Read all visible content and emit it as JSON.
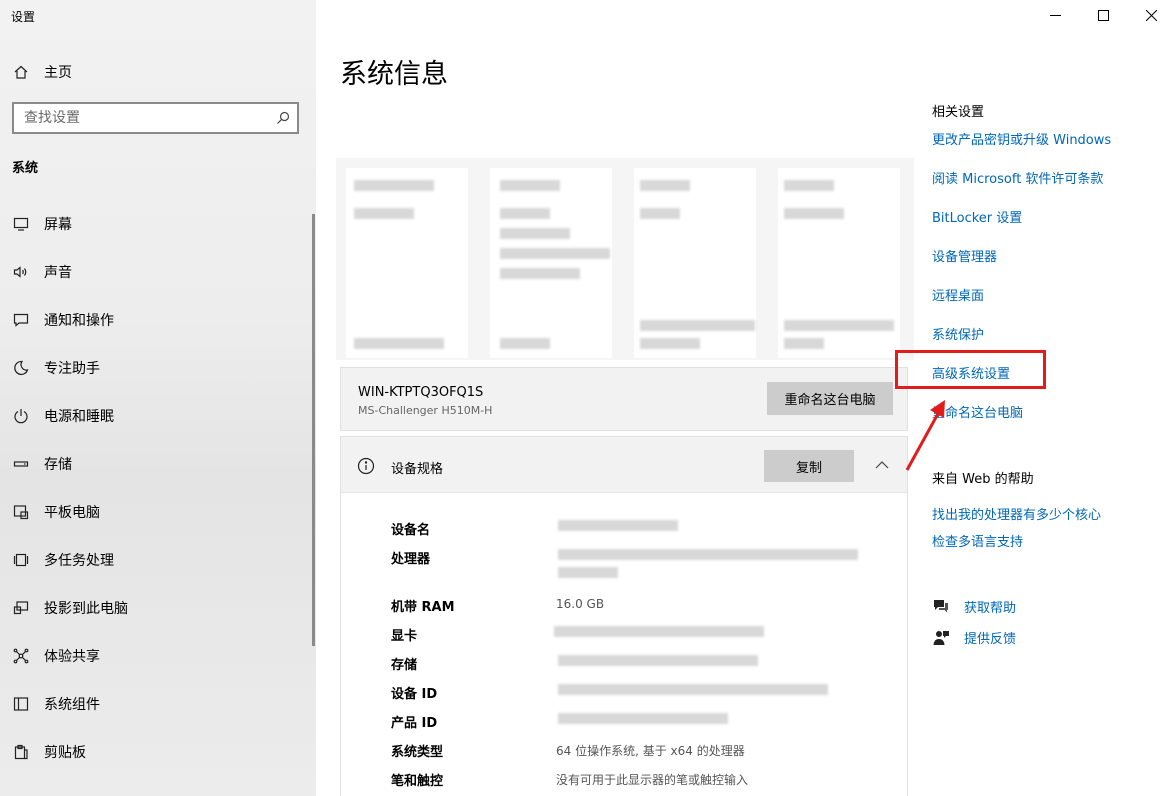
{
  "window": {
    "title": "设置"
  },
  "sidebar": {
    "home_label": "主页",
    "search_placeholder": "查找设置",
    "section_header": "系统",
    "items": [
      {
        "label": "屏幕",
        "icon": "monitor-icon"
      },
      {
        "label": "声音",
        "icon": "speaker-icon"
      },
      {
        "label": "通知和操作",
        "icon": "notification-icon"
      },
      {
        "label": "专注助手",
        "icon": "moon-icon"
      },
      {
        "label": "电源和睡眠",
        "icon": "power-icon"
      },
      {
        "label": "存储",
        "icon": "storage-icon"
      },
      {
        "label": "平板电脑",
        "icon": "tablet-icon"
      },
      {
        "label": "多任务处理",
        "icon": "multitask-icon"
      },
      {
        "label": "投影到此电脑",
        "icon": "project-icon"
      },
      {
        "label": "体验共享",
        "icon": "share-icon"
      },
      {
        "label": "系统组件",
        "icon": "components-icon"
      },
      {
        "label": "剪贴板",
        "icon": "clipboard-icon"
      }
    ]
  },
  "main": {
    "title": "系统信息",
    "pc": {
      "name": "WIN-KTPTQ3OFQ1S",
      "model": "MS-Challenger H510M-H",
      "rename_button": "重命名这台电脑"
    },
    "specs": {
      "title": "设备规格",
      "copy_button": "复制",
      "rows": [
        {
          "label": "设备名",
          "value": ""
        },
        {
          "label": "处理器",
          "value": ""
        },
        {
          "label": "机带 RAM",
          "value": "16.0 GB"
        },
        {
          "label": "显卡",
          "value": ""
        },
        {
          "label": "存储",
          "value": ""
        },
        {
          "label": "设备 ID",
          "value": ""
        },
        {
          "label": "产品 ID",
          "value": ""
        },
        {
          "label": "系统类型",
          "value": "64 位操作系统, 基于 x64 的处理器"
        },
        {
          "label": "笔和触控",
          "value": "没有可用于此显示器的笔或触控输入"
        }
      ]
    }
  },
  "related": {
    "title": "相关设置",
    "links": [
      "更改产品密钥或升级 Windows",
      "阅读 Microsoft 软件许可条款",
      "BitLocker 设置",
      "设备管理器",
      "远程桌面",
      "系统保护",
      "高级系统设置",
      "重命名这台电脑"
    ]
  },
  "web_help": {
    "title": "来自 Web 的帮助",
    "links": [
      "找出我的处理器有多少个核心",
      "检查多语言支持"
    ]
  },
  "help": {
    "get_help": "获取帮助",
    "feedback": "提供反馈"
  },
  "colors": {
    "link": "#0067b8",
    "highlight": "#e21b1b"
  }
}
